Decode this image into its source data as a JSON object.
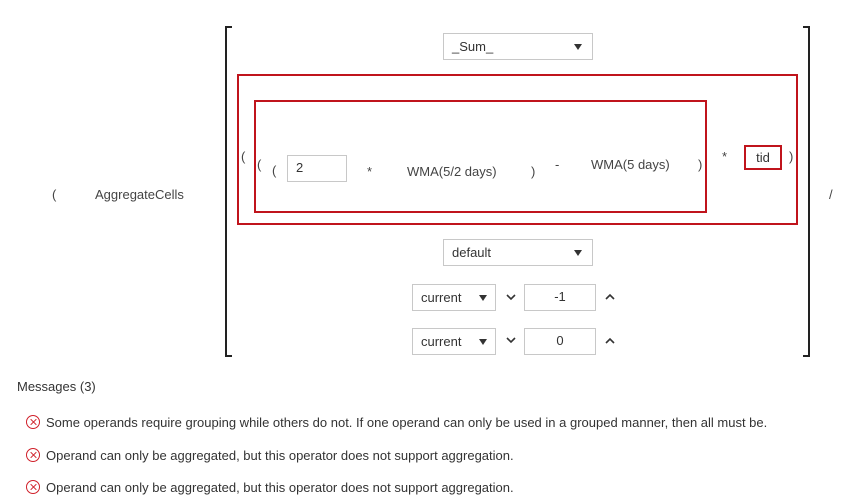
{
  "outer": {
    "open_paren": "(",
    "function_name": "AggregateCells",
    "operator_divide": "/"
  },
  "aggregation": {
    "function": "_Sum_"
  },
  "expression": {
    "paren_open_outer": "(",
    "paren_open_mid": "(",
    "paren_open_inner": "(",
    "factor_value": "2",
    "op_multiply_1": "*",
    "wma_a": "WMA(5/2 days)",
    "paren_close_inner": ")",
    "op_minus": "-",
    "wma_b": "WMA(5 days)",
    "paren_close_mid": ")",
    "op_multiply_2": "*",
    "tid": "tid",
    "paren_close_outer": ")"
  },
  "grouping": {
    "mode": "default"
  },
  "range_start": {
    "reference": "current",
    "offset": "-1"
  },
  "range_end": {
    "reference": "current",
    "offset": "0"
  },
  "messages": {
    "title": "Messages (3)",
    "items": [
      "Some operands require grouping while others do not. If one operand can only be used in a grouped manner, then all must be.",
      "Operand can only be aggregated, but this operator does not support aggregation.",
      "Operand can only be aggregated, but this operator does not support aggregation."
    ]
  },
  "colors": {
    "error_red": "#c0141c",
    "border_gray": "#c8c8c8"
  }
}
